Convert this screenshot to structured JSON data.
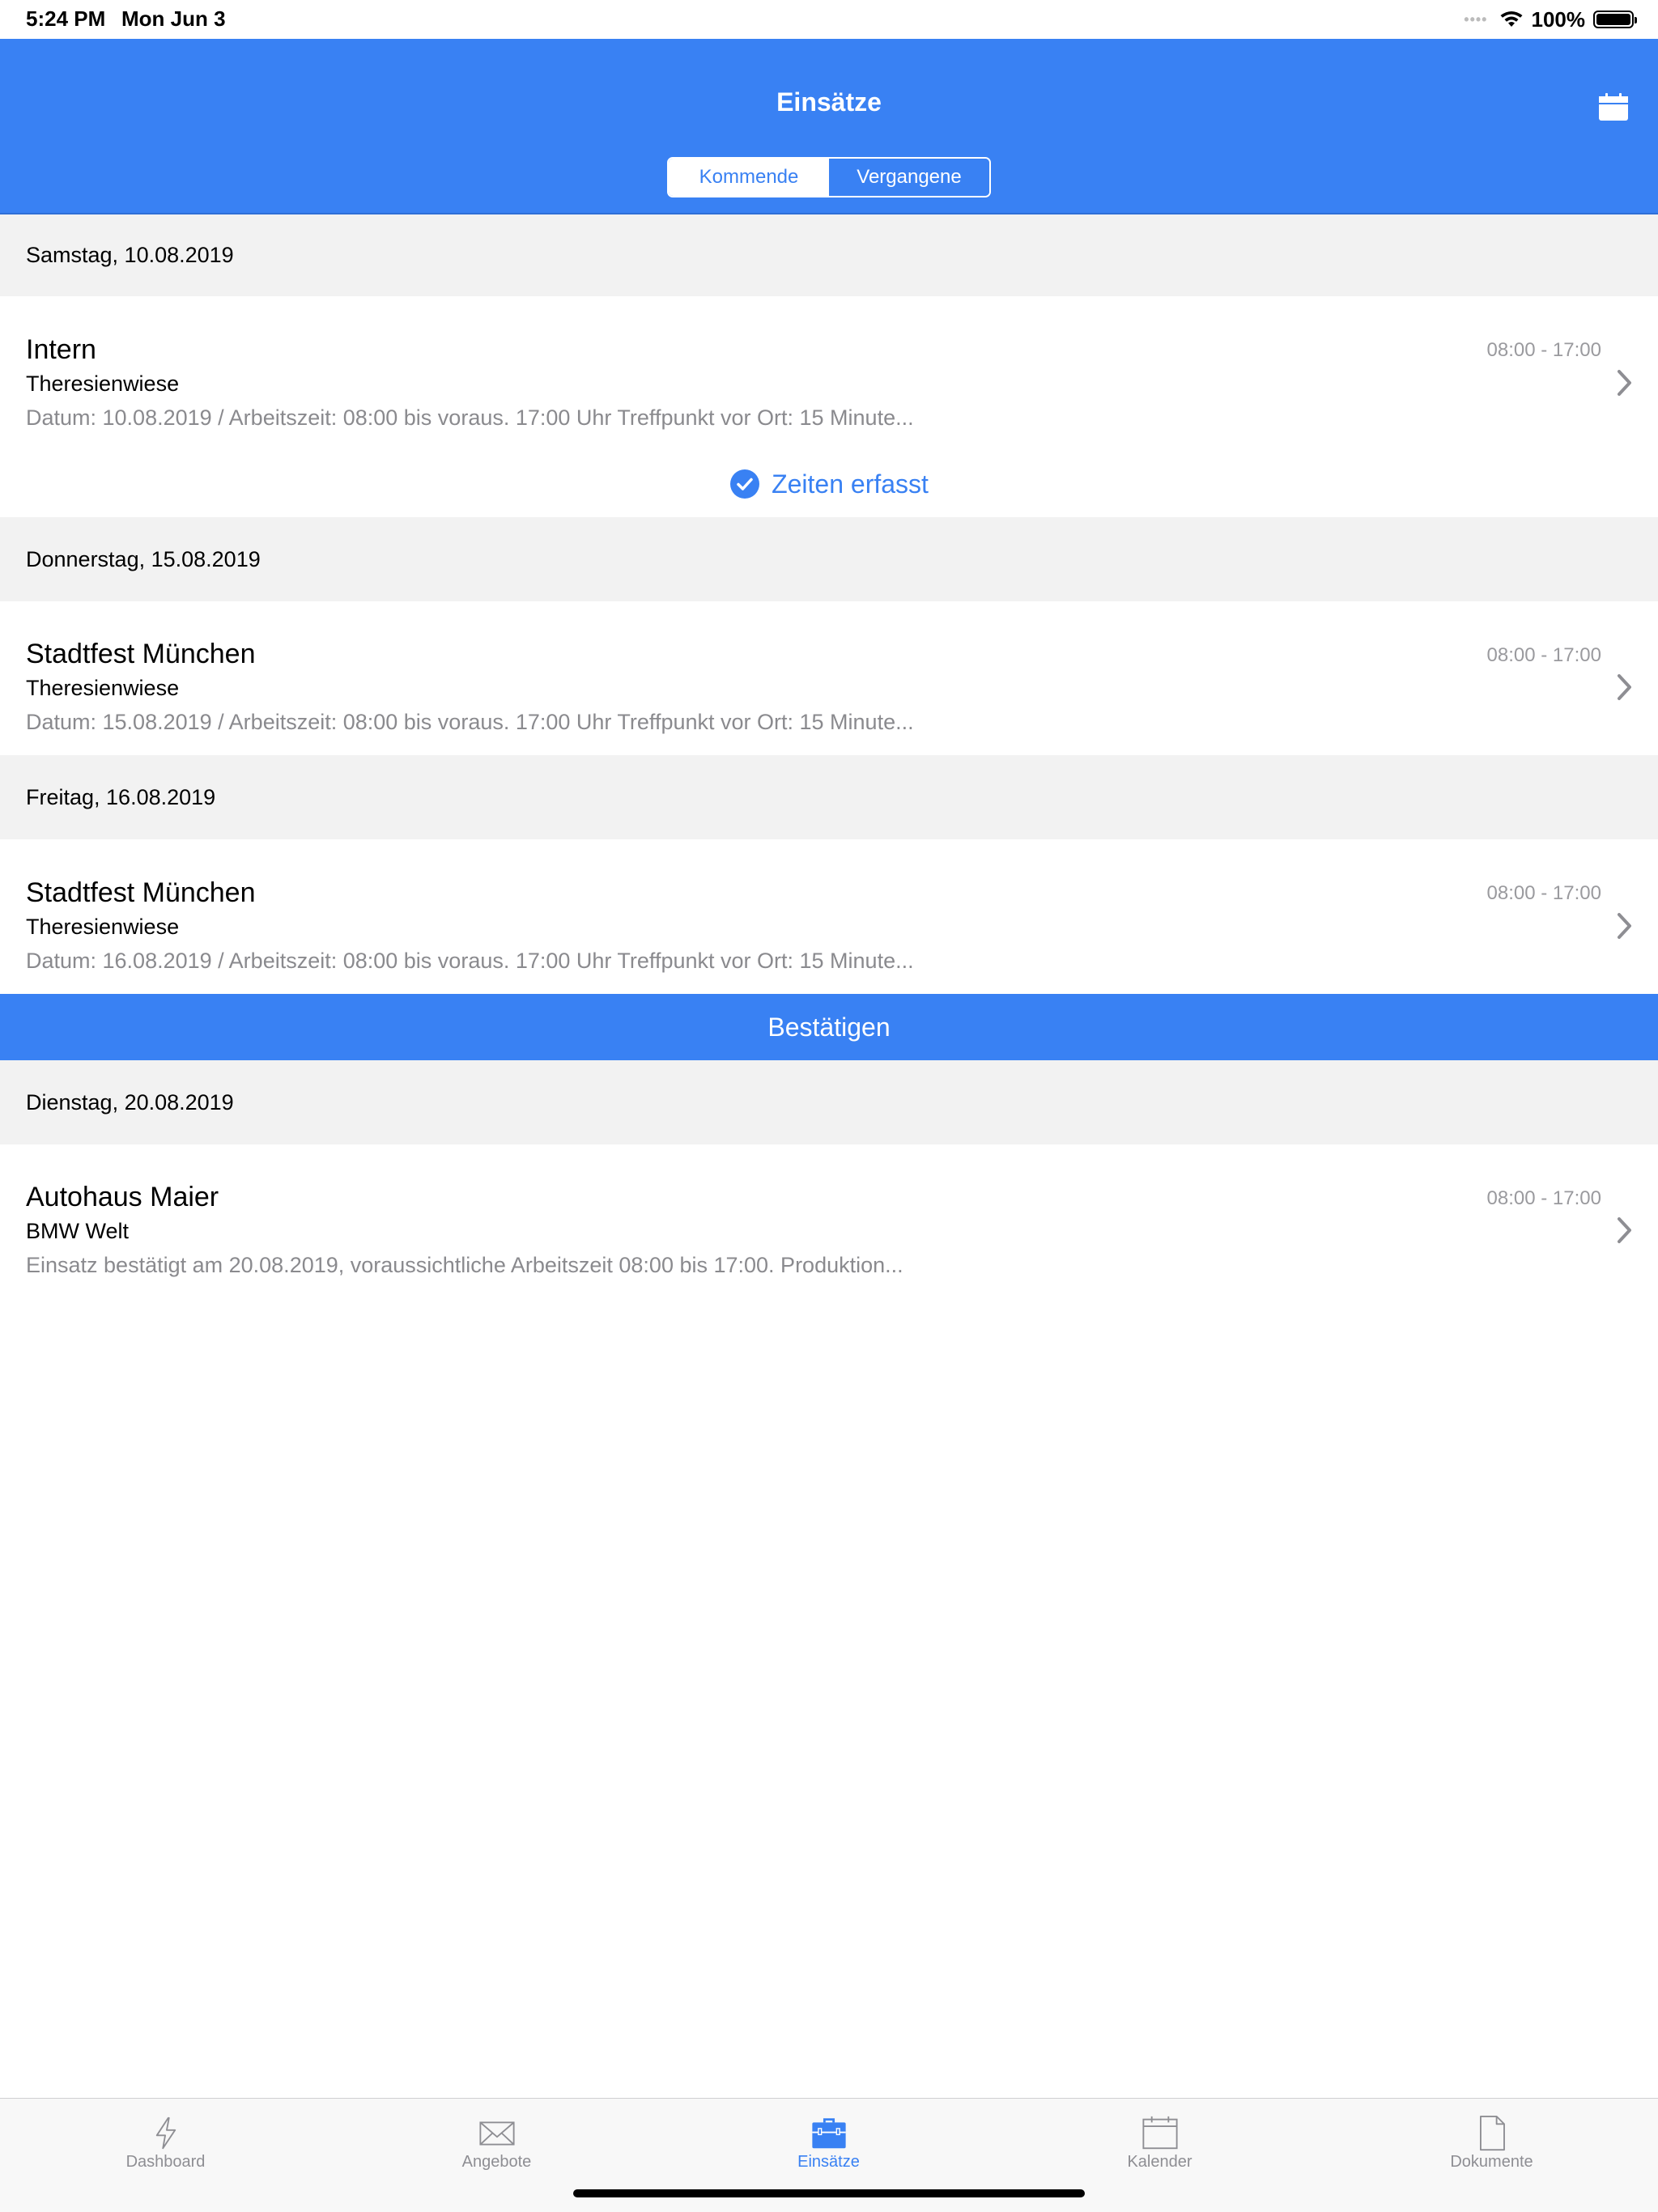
{
  "status_bar": {
    "time": "5:24 PM",
    "date": "Mon Jun 3",
    "battery": "100%"
  },
  "nav": {
    "title": "Einsätze",
    "calendar_icon": "calendar-icon",
    "segments": [
      "Kommende",
      "Vergangene"
    ],
    "selected_segment": "Kommende"
  },
  "sections": [
    {
      "header": "Samstag, 10.08.2019",
      "item": {
        "title": "Intern",
        "location": "Theresienwiese",
        "description": "Datum: 10.08.2019 / Arbeitszeit: 08:00 bis voraus. 17:00 Uhr Treffpunkt vor Ort: 15 Minute...",
        "time": "08:00 - 17:00",
        "status": "Zeiten erfasst"
      }
    },
    {
      "header": "Donnerstag, 15.08.2019",
      "item": {
        "title": "Stadtfest München",
        "location": "Theresienwiese",
        "description": "Datum: 15.08.2019 / Arbeitszeit: 08:00 bis voraus. 17:00 Uhr Treffpunkt vor Ort: 15 Minute...",
        "time": "08:00 - 17:00"
      }
    },
    {
      "header": "Freitag, 16.08.2019",
      "item": {
        "title": "Stadtfest München",
        "location": "Theresienwiese",
        "description": "Datum: 16.08.2019 / Arbeitszeit: 08:00 bis voraus. 17:00 Uhr Treffpunkt vor Ort: 15 Minute...",
        "time": "08:00 - 17:00",
        "action": "Bestätigen"
      }
    },
    {
      "header": "Dienstag, 20.08.2019",
      "item": {
        "title": "Autohaus Maier",
        "location": "BMW Welt",
        "description": "Einsatz bestätigt am 20.08.2019, voraussichtliche Arbeitszeit 08:00 bis 17:00. Produktion...",
        "time": "08:00 - 17:00"
      }
    }
  ],
  "tabbar": {
    "active": "Einsätze",
    "tabs": [
      {
        "label": "Dashboard",
        "icon": "bolt-icon"
      },
      {
        "label": "Angebote",
        "icon": "envelope-icon"
      },
      {
        "label": "Einsätze",
        "icon": "briefcase-icon"
      },
      {
        "label": "Kalender",
        "icon": "calendar-icon"
      },
      {
        "label": "Dokumente",
        "icon": "document-icon"
      }
    ]
  },
  "colors": {
    "accent": "#3981f3",
    "section_bg": "#f2f2f2",
    "secondary_text": "#8a8a8e"
  }
}
